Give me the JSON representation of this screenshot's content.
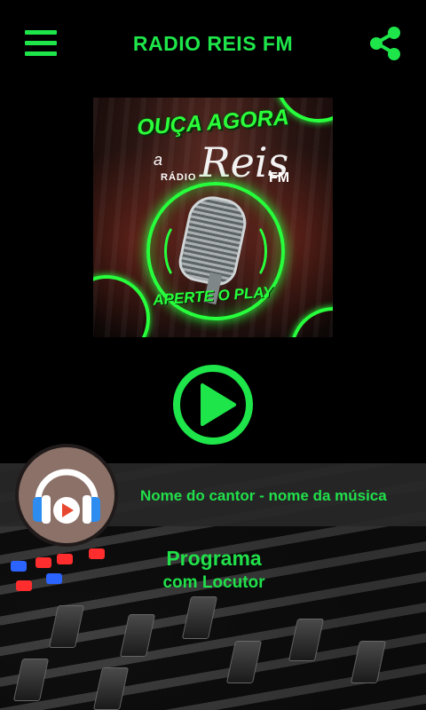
{
  "header": {
    "title": "RADIO REIS FM",
    "menu_icon": "hamburger-menu-icon",
    "share_icon": "share-icon",
    "accent_color": "#1ee64a"
  },
  "cover": {
    "headline": "OUÇA AGORA",
    "word_a": "a",
    "word_radio": "RÁDIO",
    "word_reis": "Reis",
    "word_fm": "FM",
    "call_to_action": "APERTE O PLAY"
  },
  "player": {
    "play_icon": "play-icon",
    "track_title": "Nome do cantor - nome da música",
    "avatar_icon": "headphones-play-icon"
  },
  "program": {
    "name": "Programa",
    "host": "com Locutor"
  }
}
